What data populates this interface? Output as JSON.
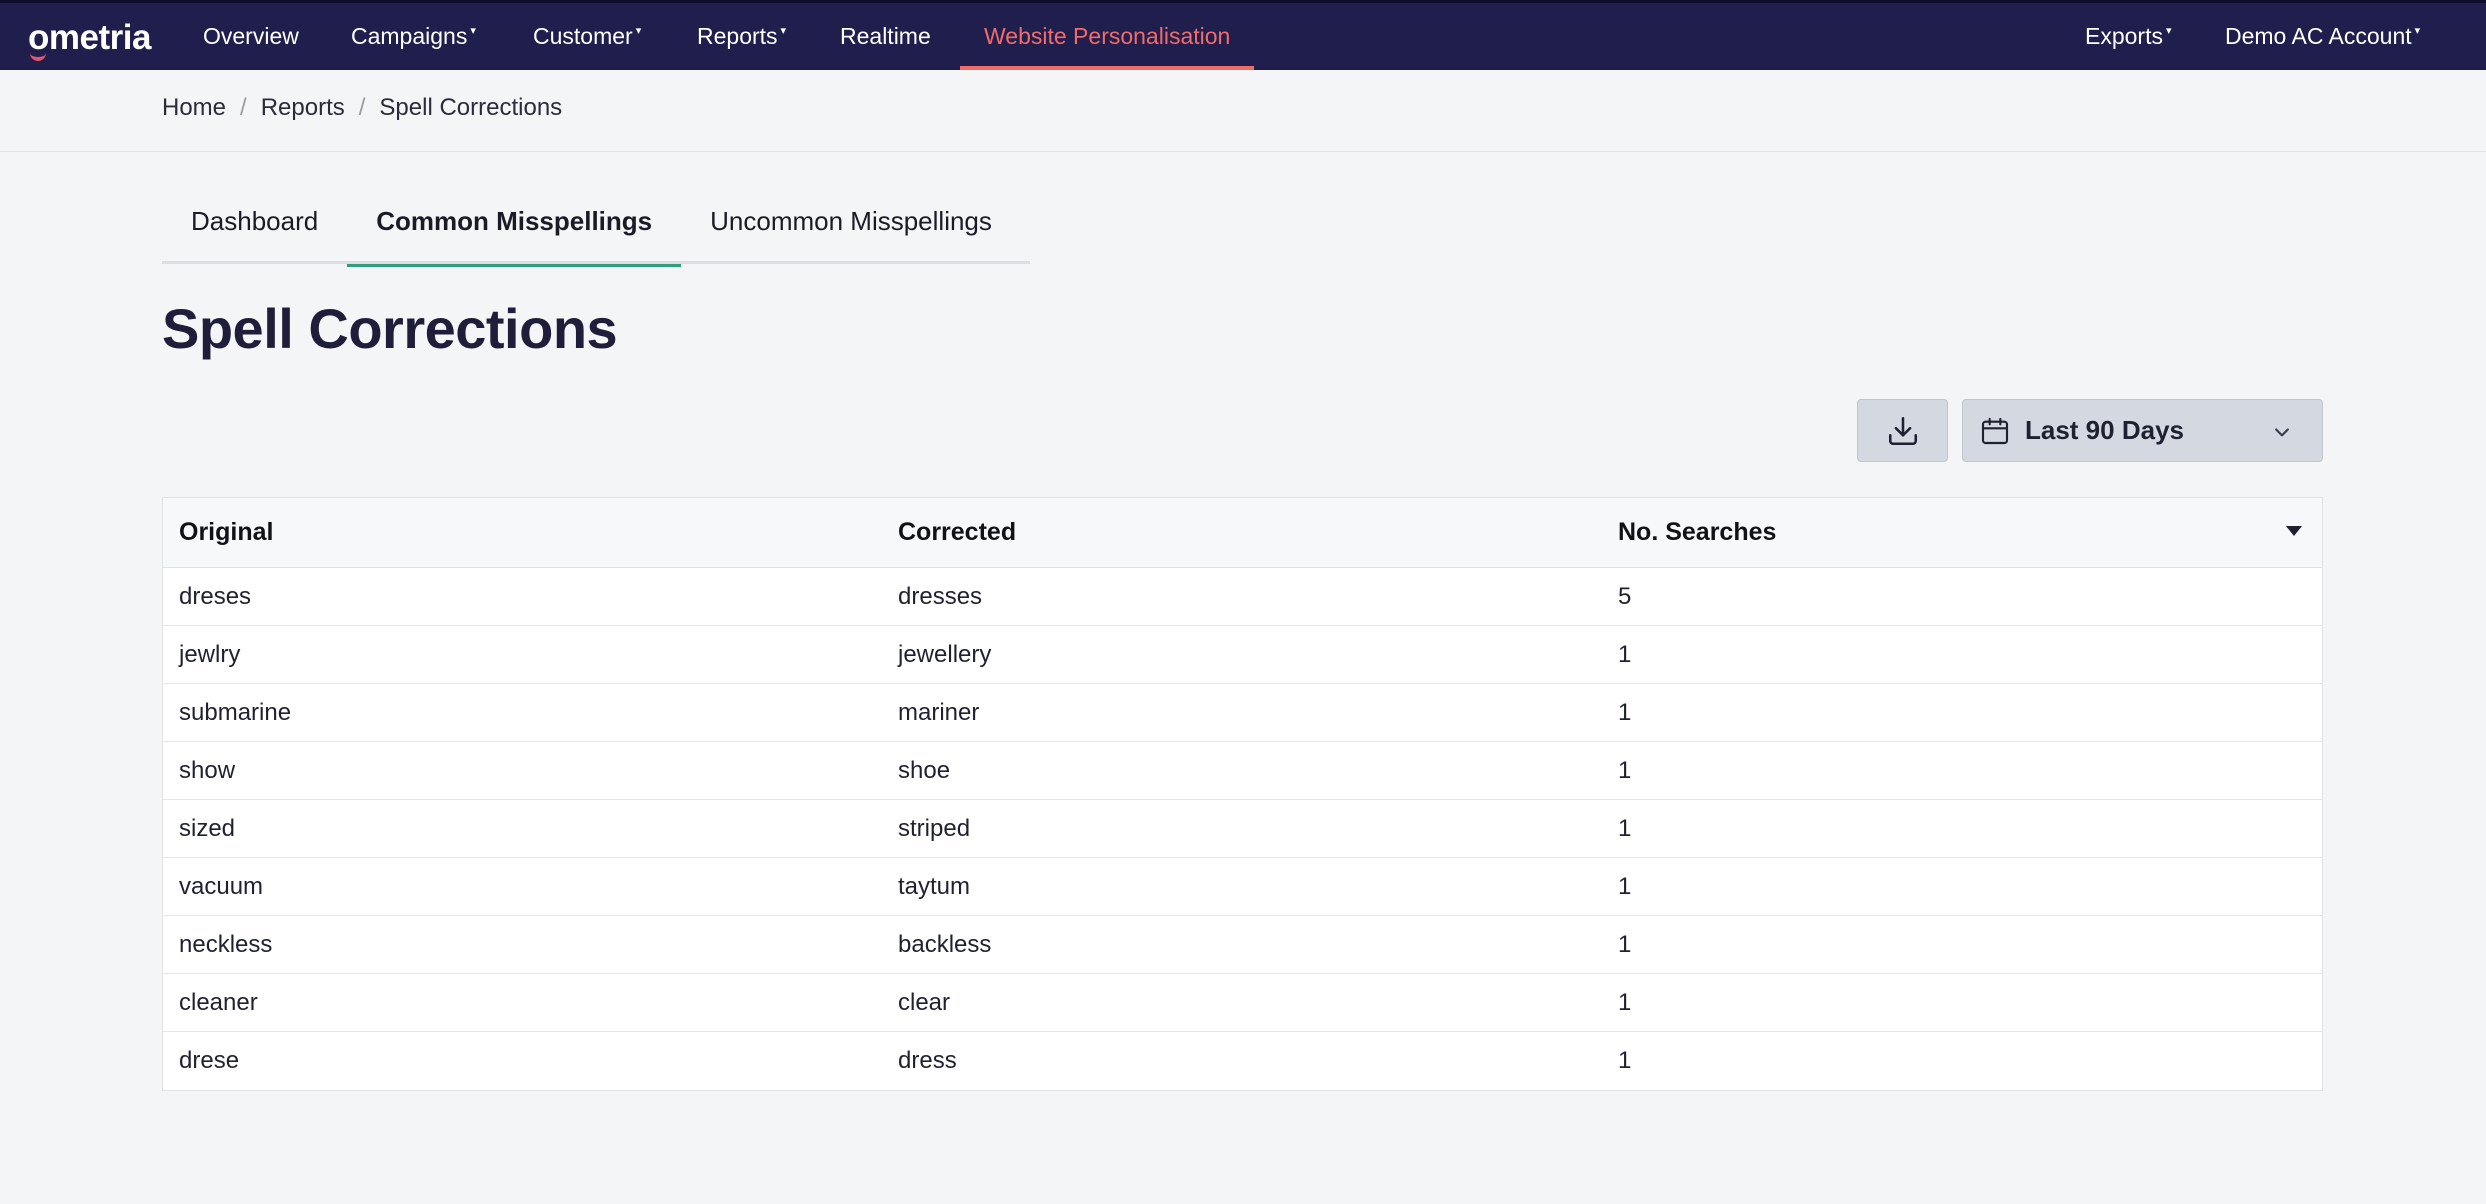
{
  "nav": {
    "logo": "ometria",
    "items": [
      {
        "label": "Overview",
        "dropdown": false
      },
      {
        "label": "Campaigns",
        "dropdown": true
      },
      {
        "label": "Customer",
        "dropdown": true
      },
      {
        "label": "Reports",
        "dropdown": true
      },
      {
        "label": "Realtime",
        "dropdown": false
      },
      {
        "label": "Website Personalisation",
        "dropdown": false,
        "active": true
      }
    ],
    "right": [
      {
        "label": "Exports",
        "dropdown": true
      },
      {
        "label": "Demo AC Account",
        "dropdown": true
      }
    ],
    "caret": "▾"
  },
  "breadcrumb": {
    "items": [
      "Home",
      "Reports",
      "Spell Corrections"
    ],
    "separator": "/"
  },
  "tabs": [
    {
      "label": "Dashboard",
      "active": false
    },
    {
      "label": "Common Misspellings",
      "active": true
    },
    {
      "label": "Uncommon Misspellings",
      "active": false
    }
  ],
  "page": {
    "title": "Spell Corrections"
  },
  "toolbar": {
    "download_icon": "download-icon",
    "date_range_label": "Last 90 Days",
    "calendar_icon": "calendar-icon"
  },
  "table": {
    "columns": [
      "Original",
      "Corrected",
      "No. Searches"
    ],
    "sort_column": "No. Searches",
    "sort_direction": "desc",
    "rows": [
      [
        "dreses",
        "dresses",
        "5"
      ],
      [
        "jewlry",
        "jewellery",
        "1"
      ],
      [
        "submarine",
        "mariner",
        "1"
      ],
      [
        "show",
        "shoe",
        "1"
      ],
      [
        "sized",
        "striped",
        "1"
      ],
      [
        "vacuum",
        "taytum",
        "1"
      ],
      [
        "neckless",
        "backless",
        "1"
      ],
      [
        "cleaner",
        "clear",
        "1"
      ],
      [
        "drese",
        "dress",
        "1"
      ]
    ]
  },
  "colors": {
    "nav_bg": "#1f1e4d",
    "accent_active_nav": "#f26b6b",
    "tab_underline": "#2f9e7a",
    "button_bg": "#d4d9e1"
  }
}
